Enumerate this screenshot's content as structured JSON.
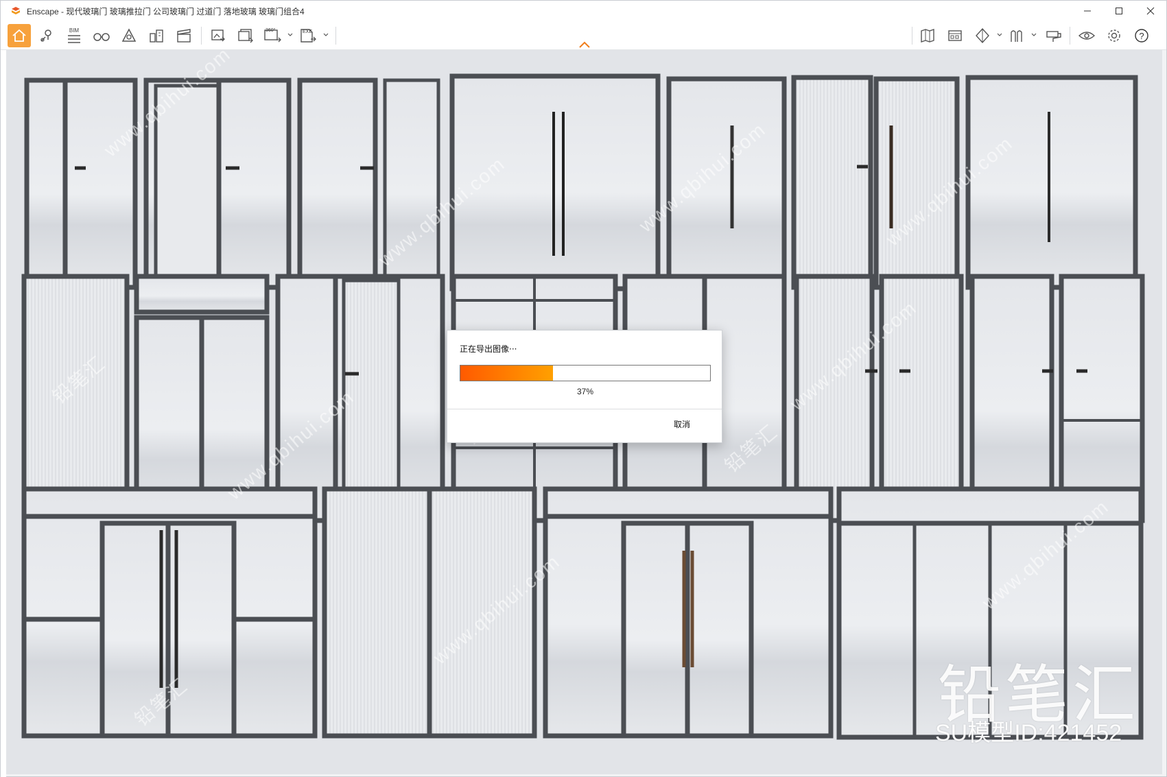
{
  "window": {
    "title": "Enscape - 现代玻璃门 玻璃推拉门 公司玻璃门 过道门 落地玻璃 玻璃门组合4"
  },
  "toolbar": {
    "bim_label": "BIM",
    "icons": [
      "home-icon",
      "location-pin-icon",
      "bim-list-icon",
      "binoculars-icon",
      "perspective-icon",
      "buildings-icon",
      "clapperboard-icon",
      "render-image-icon",
      "batch-render-icon",
      "export-360-icon",
      "export-exe-icon",
      "map-icon",
      "asset-library-icon",
      "cube-view-icon",
      "sections-icon",
      "material-icon",
      "visual-settings-icon",
      "settings-icon",
      "help-icon"
    ],
    "badge_360": "360°",
    "badge_exe": "EXE",
    "help_label": "?"
  },
  "colors": {
    "accent": "#f7a13c",
    "progress_start": "#ff5a00",
    "progress_end": "#ffa000"
  },
  "dialog": {
    "title": "正在导出图像···",
    "progress": 0.37,
    "progress_text": "37%",
    "cancel_label": "取消"
  },
  "watermark": {
    "brand": "铅笔汇",
    "model_id": "SU模型ID:421452",
    "tile_text_cn": "铅笔汇",
    "tile_text_url": "www.qbihui.com"
  }
}
